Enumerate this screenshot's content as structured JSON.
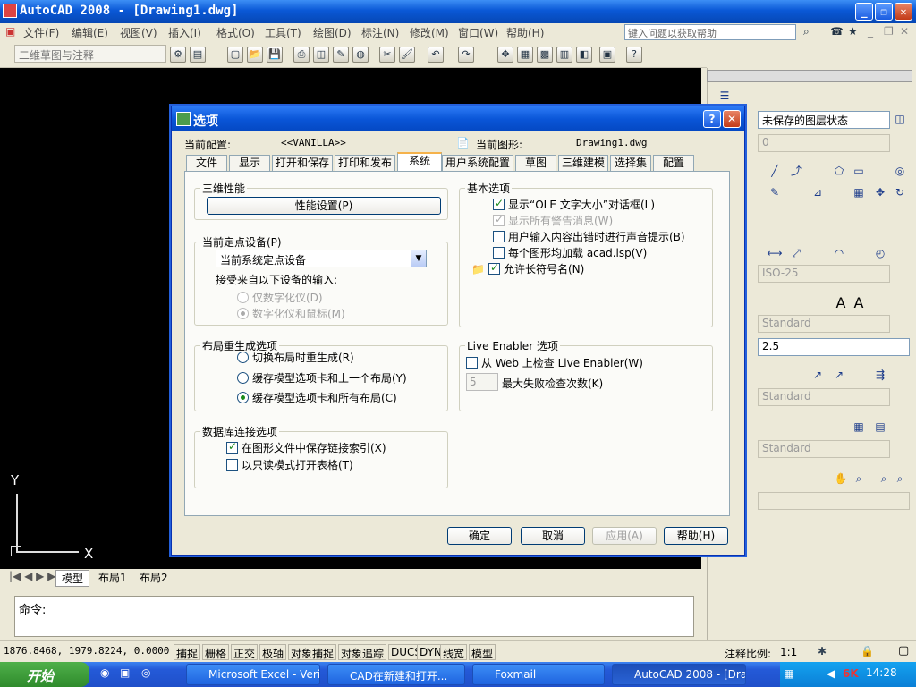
{
  "window": {
    "title": "AutoCAD 2008 - [Drawing1.dwg]",
    "help_search_placeholder": "键入问题以获取帮助"
  },
  "menu": [
    "文件(F)",
    "编辑(E)",
    "视图(V)",
    "插入(I)",
    "格式(O)",
    "工具(T)",
    "绘图(D)",
    "标注(N)",
    "修改(M)",
    "窗口(W)",
    "帮助(H)"
  ],
  "toolbar": {
    "workspace": "二维草图与注释"
  },
  "drawing": {
    "ucs_y": "Y",
    "ucs_x": "X"
  },
  "layout_tabs": [
    "模型",
    "布局1",
    "布局2"
  ],
  "command": {
    "prompt": "命令:"
  },
  "statusbar": {
    "coords": "1876.8468, 1979.8224, 0.0000",
    "buttons": [
      "捕捉",
      "栅格",
      "正交",
      "极轴",
      "对象捕捉",
      "对象追踪",
      "DUCS",
      "DYN",
      "线宽",
      "模型"
    ],
    "anno_scale_label": "注释比例:",
    "anno_scale_value": "1:1"
  },
  "taskbar": {
    "start": "开始",
    "tasks": [
      "Microsoft Excel - Verif...",
      "CAD在新建和打开...",
      "Foxmail",
      "AutoCAD 2008 - [Dra..."
    ],
    "clock": "14:28"
  },
  "palette": {
    "layer_state": "未保存的图层状态",
    "layer_value": "0",
    "dim_style": "ISO-25",
    "text_style": "Standard",
    "text_height": "2.5",
    "mleader_style": "Standard",
    "table_style": "Standard"
  },
  "dialog": {
    "title": "选项",
    "current_profile_label": "当前配置:",
    "current_profile": "<<VANILLA>>",
    "current_drawing_label": "当前图形:",
    "current_drawing": "Drawing1.dwg",
    "tabs": [
      "文件",
      "显示",
      "打开和保存",
      "打印和发布",
      "系统",
      "用户系统配置",
      "草图",
      "三维建模",
      "选择集",
      "配置"
    ],
    "active_tab": "系统",
    "perf_group": "三维性能",
    "perf_button": "性能设置(P)",
    "pointing_group": "当前定点设备(P)",
    "pointing_device": "当前系统定点设备",
    "accept_input_label": "接受来自以下设备的输入:",
    "radio_digitizer_only": "仅数字化仪(D)",
    "radio_digitizer_mouse": "数字化仪和鼠标(M)",
    "regen_group": "布局重生成选项",
    "regen_opt1": "切换布局时重生成(R)",
    "regen_opt2": "缓存模型选项卡和上一个布局(Y)",
    "regen_opt3": "缓存模型选项卡和所有布局(C)",
    "db_group": "数据库连接选项",
    "db_opt1": "在图形文件中保存链接索引(X)",
    "db_opt2": "以只读模式打开表格(T)",
    "general_group": "基本选项",
    "general_opt1": "显示“OLE 文字大小”对话框(L)",
    "general_opt2": "显示所有警告消息(W)",
    "general_opt3": "用户输入内容出错时进行声音提示(B)",
    "general_opt4": "每个图形均加载 acad.lsp(V)",
    "general_opt5": "允许长符号名(N)",
    "live_group": "Live Enabler 选项",
    "live_opt1": "从 Web 上检查 Live Enabler(W)",
    "live_max_value": "5",
    "live_max_label": "最大失败检查次数(K)",
    "ok": "确定",
    "cancel": "取消",
    "apply": "应用(A)",
    "help": "帮助(H)"
  }
}
